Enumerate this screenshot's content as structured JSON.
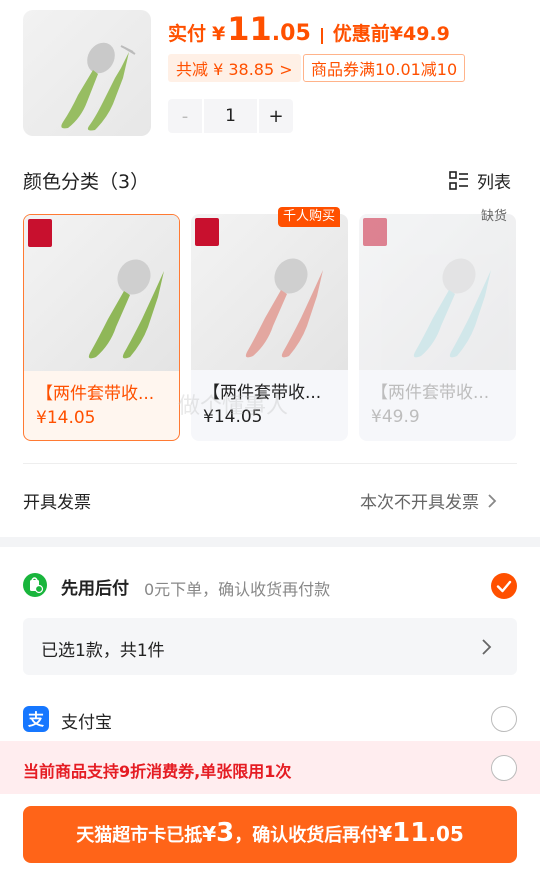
{
  "header": {
    "price_label": "实付",
    "currency": "¥",
    "price_int": "11",
    "price_dec": ".05",
    "original_label": "优惠前",
    "original_price": "¥49.9",
    "discount_tag": "共减 ¥ 38.85 >",
    "coupon_tag": "商品券满10.01减10"
  },
  "stepper": {
    "minus": "-",
    "qty": "1",
    "plus": "+"
  },
  "variants": {
    "title": "颜色分类（3）",
    "view_toggle": "列表",
    "items": [
      {
        "name": "【两件套带收...",
        "price": "¥14.05",
        "color": "green",
        "state": "selected",
        "badge": ""
      },
      {
        "name": "【两件套带收...",
        "price": "¥14.05",
        "color": "pink",
        "state": "normal",
        "badge": "千人购买"
      },
      {
        "name": "【两件套带收...",
        "price": "¥49.9",
        "color": "blue",
        "state": "sold-out",
        "badge": "缺货"
      }
    ],
    "watermark": "做个懂事人"
  },
  "invoice": {
    "label": "开具发票",
    "value": "本次不开具发票"
  },
  "payment": {
    "later_title": "先用后付",
    "later_desc": "0元下单，确认收货再付款",
    "selected_summary": "已选1款，共1件",
    "alipay_label": "支付宝",
    "notice": "当前商品支持9折消费券,单张限用1次"
  },
  "cta": {
    "part1": "天猫超市卡已抵",
    "currency": "¥",
    "amount": "3",
    "part2": "，确认收货后再付",
    "currency2": "¥",
    "total_int": "11",
    "total_dec": ".05"
  },
  "colors": {
    "accent": "#ff5000",
    "green": "#19b53c",
    "alipay": "#1677ff",
    "notice_bg": "#ffedef"
  }
}
